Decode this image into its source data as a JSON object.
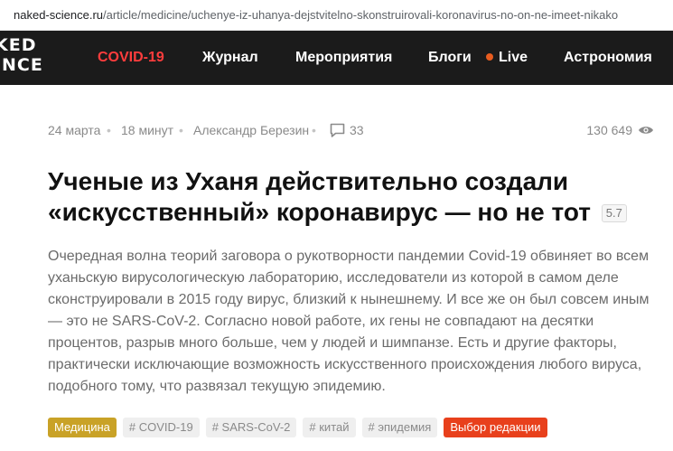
{
  "browser": {
    "host": "naked-science.ru",
    "path": "/article/medicine/uchenye-iz-uhanya-dejstvitelno-skonstruirovali-koronavirus-no-on-ne-imeet-nikako"
  },
  "logo": {
    "line1": "KED",
    "line2": "ENCE"
  },
  "nav": {
    "covid": "COVID-19",
    "journal": "Журнал",
    "events": "Мероприятия",
    "blogs": "Блоги",
    "live": "Live",
    "astronomy": "Астрономия"
  },
  "meta": {
    "date": "24 марта",
    "read_time": "18 минут",
    "author": "Александр Березин",
    "comments": "33",
    "views": "130 649"
  },
  "article": {
    "title": "Ученые из Уханя действительно создали «искусственный» коронавирус — но не тот",
    "rating": "5.7",
    "lead": "Очередная волна теорий заговора о рукотворности пандемии Covid-19 обвиняет во всем уханьскую вирусологическую лабораторию, исследователи из которой в самом деле сконструировали в 2015 году вирус, близкий к нынешнему. И все же он был совсем иным — это не SARS-CoV-2. Согласно новой работе, их гены не совпадают на десятки процентов, разрыв много больше, чем у людей и шимпанзе. Есть и другие факторы, практически исключающие возможность искусственного происхождения любого вируса, подобного тому, что развязал текущую эпидемию."
  },
  "tags": {
    "rubric": "Медицина",
    "items": [
      "# COVID-19",
      "# SARS-CoV-2",
      "# китай",
      "# эпидемия"
    ],
    "editors_choice": "Выбор редакции"
  },
  "colors": {
    "nav_bg": "#1b1b1b",
    "covid_red": "#ff3d3d",
    "live_dot": "#e85c1f",
    "rubric_gold": "#c9a227",
    "editor_red": "#e8401c"
  }
}
